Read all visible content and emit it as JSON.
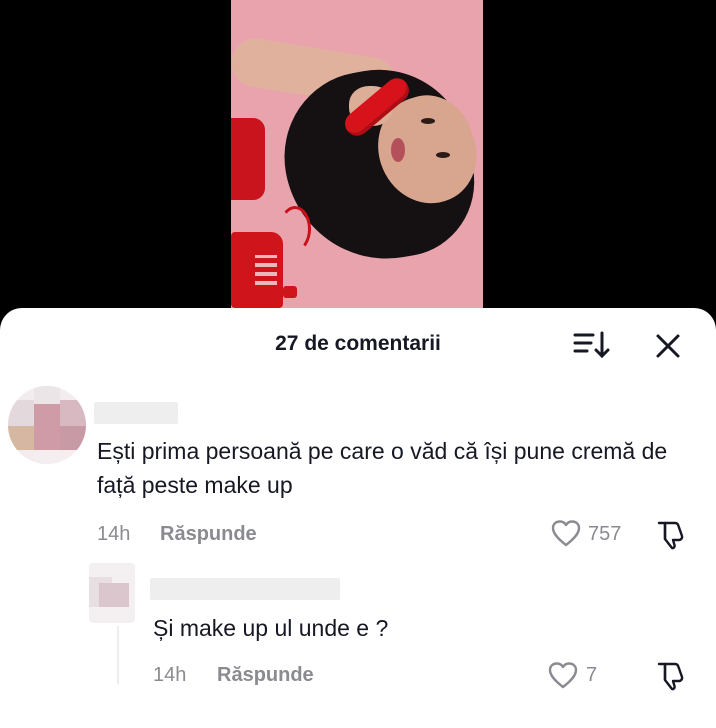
{
  "video": {},
  "header": {
    "title": "27 de comentarii"
  },
  "comments": [
    {
      "text": "Ești prima persoană pe care o văd că își pune cremă de față peste make up",
      "time": "14h",
      "reply_label": "Răspunde",
      "likes": "757"
    },
    {
      "text": "Și make up ul unde e ?",
      "time": "14h",
      "reply_label": "Răspunde",
      "likes": "7"
    }
  ],
  "colors": {
    "sheet_bg": "#ffffff",
    "text_primary": "#161823",
    "text_secondary": "#8a8b91",
    "video_bg": "#e9a3ac"
  },
  "icons": [
    "sort-icon",
    "close-icon",
    "heart-icon",
    "dislike-icon"
  ]
}
